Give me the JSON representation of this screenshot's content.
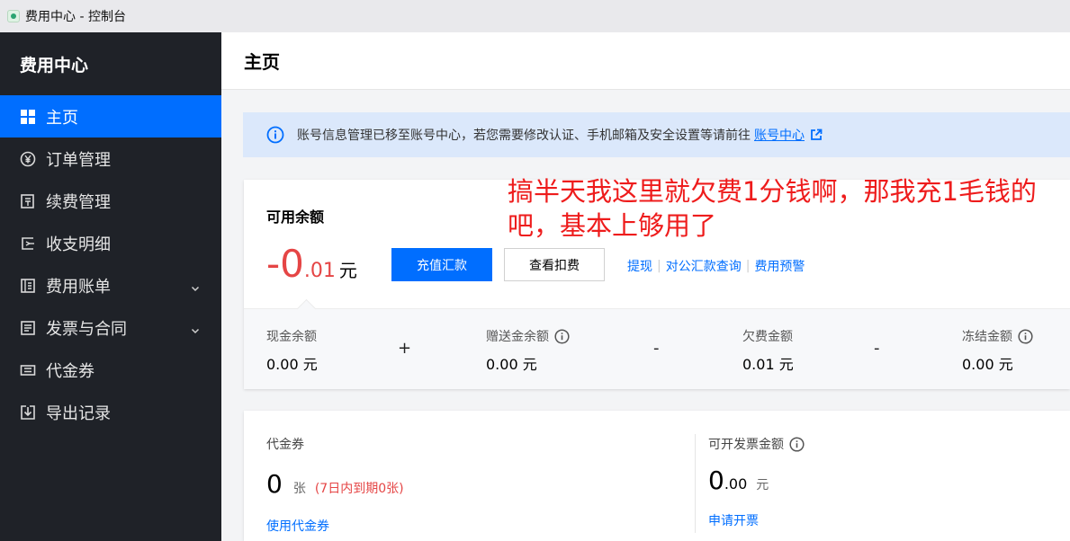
{
  "window": {
    "title": "费用中心 - 控制台"
  },
  "sidebar": {
    "brand": "费用中心",
    "items": [
      {
        "label": "主页",
        "icon": "grid-icon",
        "active": true
      },
      {
        "label": "订单管理",
        "icon": "yuan-circle-icon"
      },
      {
        "label": "续费管理",
        "icon": "renew-icon"
      },
      {
        "label": "收支明细",
        "icon": "detail-icon"
      },
      {
        "label": "费用账单",
        "icon": "bill-icon",
        "expandable": true
      },
      {
        "label": "发票与合同",
        "icon": "invoice-icon",
        "expandable": true
      },
      {
        "label": "代金券",
        "icon": "voucher-icon"
      },
      {
        "label": "导出记录",
        "icon": "export-icon"
      }
    ]
  },
  "header": {
    "title": "主页"
  },
  "notice": {
    "text": "账号信息管理已移至账号中心，若您需要修改认证、手机邮箱及安全设置等请前往",
    "link": "账号中心"
  },
  "balance": {
    "label": "可用余额",
    "amount_int": "-0",
    "amount_dec": ".01",
    "unit": "元",
    "recharge_button": "充值汇款",
    "deduct_button": "查看扣费",
    "links": [
      "提现",
      "对公汇款查询",
      "费用预警"
    ],
    "items": [
      {
        "label": "现金余额",
        "value": "0.00 元"
      },
      {
        "label": "赠送金余额",
        "value": "0.00 元"
      },
      {
        "label": "欠费金额",
        "value": "0.01 元"
      },
      {
        "label": "冻结金额",
        "value": "0.00 元"
      }
    ],
    "operators": [
      "+",
      "-",
      "-"
    ]
  },
  "voucher": {
    "label": "代金券",
    "count": "0",
    "unit": "张",
    "expire": "(7日内到期0张)",
    "link": "使用代金券"
  },
  "invoice": {
    "label": "可开发票金额",
    "amount_int": "0",
    "amount_dec": ".00",
    "unit": "元",
    "link": "申请开票"
  },
  "annotation": {
    "text": "搞半天我这里就欠费1分钱啊，那我充1毛钱的吧，基本上够用了"
  },
  "colors": {
    "accent": "#006eff",
    "sidebar_bg": "#1f2228",
    "negative": "#e54545",
    "annotation": "#ee1c1c"
  }
}
